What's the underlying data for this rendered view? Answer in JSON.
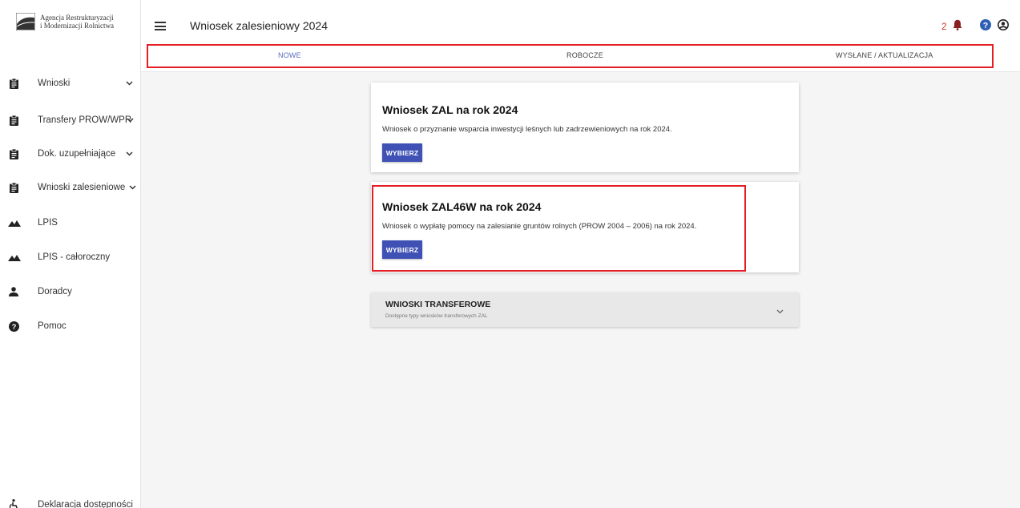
{
  "brand": {
    "line1": "Agencja Restrukturyzacji",
    "line2": "i Modernizacji Rolnictwa"
  },
  "header": {
    "title": "Wniosek zalesieniowy 2024",
    "notification_count": "2"
  },
  "sidebar": {
    "items": [
      {
        "label": "Wnioski",
        "icon": "clipboard-icon",
        "has_chevron": true
      },
      {
        "label": "Transfery PROW/WPR",
        "icon": "clipboard-icon",
        "has_chevron": true
      },
      {
        "label": "Dok. uzupełniające",
        "icon": "clipboard-icon",
        "has_chevron": true
      },
      {
        "label": "Wnioski zalesieniowe",
        "icon": "clipboard-icon",
        "has_chevron": true
      },
      {
        "label": "LPIS",
        "icon": "mountain-icon",
        "has_chevron": false
      },
      {
        "label": "LPIS - całoroczny",
        "icon": "mountain-icon",
        "has_chevron": false
      },
      {
        "label": "Doradcy",
        "icon": "person-icon",
        "has_chevron": false
      },
      {
        "label": "Pomoc",
        "icon": "help-icon",
        "has_chevron": false
      }
    ],
    "footer": {
      "label": "Deklaracja dostępności",
      "icon": "accessibility-icon"
    }
  },
  "tabs": [
    {
      "label": "NOWE",
      "active": true
    },
    {
      "label": "ROBOCZE",
      "active": false
    },
    {
      "label": "WYSŁANE / AKTUALIZACJA",
      "active": false
    }
  ],
  "cards": [
    {
      "title": "Wniosek ZAL na rok 2024",
      "description": "Wniosek o przyznanie wsparcia inwestycji leśnych lub zadrzewieniowych na rok 2024.",
      "button": "WYBIERZ"
    },
    {
      "title": "Wniosek ZAL46W na rok 2024",
      "description": "Wniosek o wypłatę pomocy na zalesianie gruntów rolnych (PROW 2004 – 2006) na rok 2024.",
      "button": "WYBIERZ"
    }
  ],
  "transfer_panel": {
    "title": "WNIOSKI TRANSFEROWE",
    "subtitle": "Dostępne typy wniosków transferowych ZAL"
  },
  "colors": {
    "primary": "#3f51b5",
    "highlight": "#e31e24",
    "active_tab": "#5a6cc0",
    "notification": "#c0392b",
    "help_icon": "#2d5fb5"
  }
}
